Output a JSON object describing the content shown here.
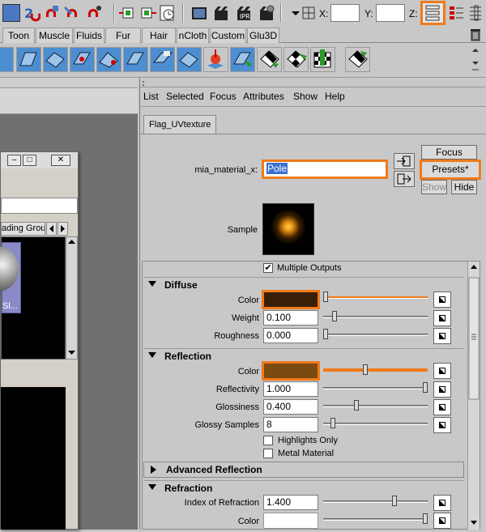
{
  "status_line": {
    "x_label": "X:",
    "y_label": "Y:",
    "z_label": "Z:",
    "x_value": "",
    "y_value": "",
    "z_value": ""
  },
  "shelf_tabs": [
    "Toon",
    "Muscle",
    "Fluids",
    "Fur",
    "Hair",
    "nCloth",
    "Custom",
    "Glu3D"
  ],
  "hypershade": {
    "tab_label": "ading Group",
    "swatch_label": "Sl..."
  },
  "attribute_editor": {
    "menu": [
      "List",
      "Selected",
      "Focus",
      "Attributes",
      "Show",
      "Help"
    ],
    "node_tab": "Flag_UVtexture",
    "material_label": "mia_material_x:",
    "material_value": "Pole",
    "focus_label": "Focus",
    "presets_label": "Presets*",
    "show_label": "Show",
    "hide_label": "Hide",
    "sample_label": "Sample",
    "multiple_outputs": "Multiple Outputs",
    "sections": {
      "diffuse": "Diffuse",
      "reflection": "Reflection",
      "advanced_reflection": "Advanced Reflection",
      "refraction": "Refraction"
    },
    "diffuse": {
      "color_label": "Color",
      "weight_label": "Weight",
      "weight_value": "0.100",
      "roughness_label": "Roughness",
      "roughness_value": "0.000"
    },
    "reflection": {
      "color_label": "Color",
      "reflectivity_label": "Reflectivity",
      "reflectivity_value": "1.000",
      "glossiness_label": "Glossiness",
      "glossiness_value": "0.400",
      "glossy_samples_label": "Glossy Samples",
      "glossy_samples_value": "8",
      "highlights_only": "Highlights Only",
      "metal_material": "Metal Material"
    },
    "refraction": {
      "ior_label": "Index of Refraction",
      "ior_value": "1.400",
      "color_label": "Color"
    }
  },
  "colors": {
    "highlight": "#f07a1a",
    "diffuse_color": "#3a1f08",
    "reflection_color": "#7a4a10",
    "refraction_color": "#ffffff"
  }
}
